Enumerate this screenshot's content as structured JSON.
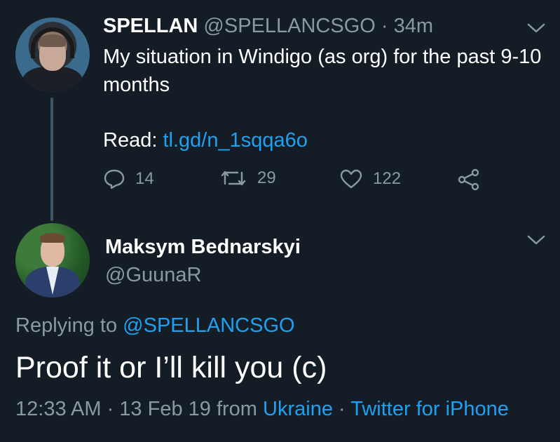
{
  "parent_tweet": {
    "display_name": "SPELLAN",
    "handle": "@SPELLANCSGO",
    "separator": "·",
    "time_ago": "34m",
    "text": "My situation in Windigo (as org) for the past 9-10 months",
    "read_label": "Read:",
    "link": "tl.gd/n_1sqqa6o",
    "actions": {
      "reply_count": "14",
      "retweet_count": "29",
      "like_count": "122"
    }
  },
  "reply_tweet": {
    "display_name": "Maksym Bednarskyi",
    "handle": "@GuunaR",
    "replying_label": "Replying to",
    "replying_handle": "@SPELLANCSGO",
    "text": "Proof it or I’ll kill you (c)",
    "timestamp": "12:33 AM · 13 Feb 19 from",
    "location": "Ukraine",
    "meta_separator": "·",
    "client": "Twitter for iPhone"
  },
  "colors": {
    "background": "#141d26",
    "text": "#ffffff",
    "secondary": "#8899a6",
    "link": "#1da1f2",
    "thread_line": "#3d5466"
  },
  "icons": [
    "reply-icon",
    "retweet-icon",
    "like-icon",
    "share-icon",
    "chevron-down-icon"
  ]
}
